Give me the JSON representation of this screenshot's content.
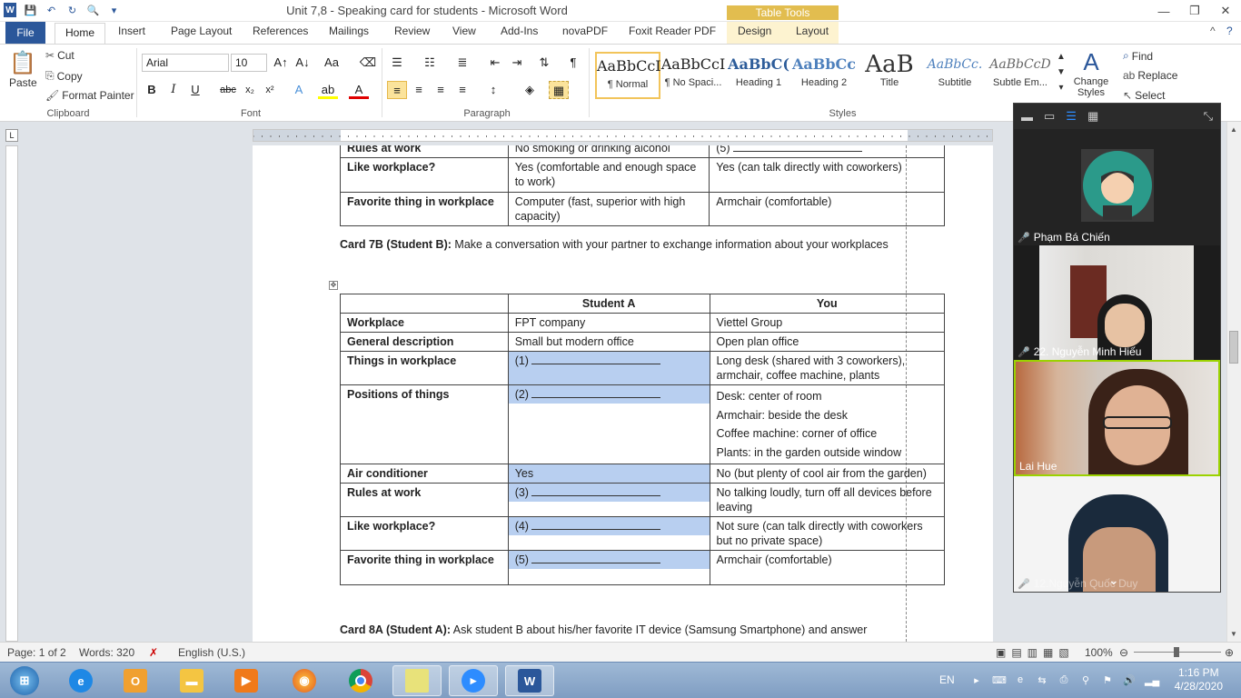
{
  "window": {
    "title": "Unit 7,8 - Speaking card for students - Microsoft Word",
    "context_tab_group": "Table Tools",
    "controls": [
      "—",
      "❐",
      "✕"
    ]
  },
  "tabs": {
    "file": "File",
    "items": [
      "Home",
      "Insert",
      "Page Layout",
      "References",
      "Mailings",
      "Review",
      "View",
      "Add-Ins",
      "novaPDF",
      "Foxit Reader PDF",
      "Design",
      "Layout"
    ]
  },
  "ribbon": {
    "clipboard": {
      "paste": "Paste",
      "cut": "Cut",
      "copy": "Copy",
      "format_painter": "Format Painter",
      "label": "Clipboard"
    },
    "font": {
      "name": "Arial",
      "size": "10",
      "label": "Font"
    },
    "paragraph": {
      "label": "Paragraph"
    },
    "styles": {
      "items": [
        {
          "preview": "AaBbCcI",
          "name": "¶ Normal"
        },
        {
          "preview": "AaBbCcI",
          "name": "¶ No Spaci..."
        },
        {
          "preview": "AaBbC(",
          "name": "Heading 1"
        },
        {
          "preview": "AaBbCc",
          "name": "Heading 2"
        },
        {
          "preview": "AaB",
          "name": "Title"
        },
        {
          "preview": "AaBbCc.",
          "name": "Subtitle"
        },
        {
          "preview": "AaBbCcD",
          "name": "Subtle Em..."
        }
      ],
      "change_styles": "Change Styles",
      "label": "Styles"
    },
    "editing": {
      "find": "Find",
      "replace": "Replace",
      "select": "Select"
    }
  },
  "document": {
    "top_table_rows": [
      {
        "label": "Rules at work",
        "a": "No smoking or drinking alcohol",
        "b": "(5)"
      },
      {
        "label": "Like workplace?",
        "a": "Yes (comfortable and enough space to work)",
        "b": "Yes (can talk directly with coworkers)"
      },
      {
        "label": "Favorite thing in workplace",
        "a": "Computer (fast, superior with high capacity)",
        "b": "Armchair (comfortable)"
      }
    ],
    "card7b": {
      "bold": "Card 7B (Student B):",
      "text": "Make a conversation with your partner to exchange information about your workplaces"
    },
    "table": {
      "headers": [
        "",
        "Student A",
        "You"
      ],
      "rows": [
        {
          "label": "Workplace",
          "a": "FPT company",
          "b": "Viettel Group"
        },
        {
          "label": "General description",
          "a": "Small but modern office",
          "b": "Open plan office"
        },
        {
          "label": "Things in workplace",
          "a": "(1)",
          "b": "Long desk (shared with 3 coworkers), armchair, coffee machine, plants"
        },
        {
          "label": "Positions of things",
          "a": "(2)",
          "b1": "Desk: center of room",
          "b2": "Armchair: beside the desk",
          "b3": "Coffee machine: corner of office",
          "b4": "Plants: in the garden outside window"
        },
        {
          "label": "Air conditioner",
          "a": "Yes",
          "b": "No (but plenty of cool air from the garden)"
        },
        {
          "label": "Rules at work",
          "a": "(3)",
          "b": "No talking loudly, turn off all devices before leaving"
        },
        {
          "label": "Like workplace?",
          "a": "(4)",
          "b": "Not sure (can talk directly with coworkers but no private space)"
        },
        {
          "label": "Favorite thing in workplace",
          "a": "(5)",
          "b": "Armchair (comfortable)"
        }
      ]
    },
    "card8a": {
      "bold": "Card 8A (Student A):",
      "text": "Ask student B about his/her favorite IT device (Samsung Smartphone) and answer"
    }
  },
  "statusbar": {
    "page": "Page: 1 of 2",
    "words": "Words: 320",
    "language": "English (U.S.)",
    "zoom": "100%"
  },
  "zoom_panel": {
    "participants": [
      {
        "name": "Phạm Bá Chiến",
        "muted": true
      },
      {
        "name": "22. Nguyễn Minh Hiếu",
        "muted": true
      },
      {
        "name": "Lai Hue",
        "muted": false
      },
      {
        "name": "12.Nguyễn Quốc Duy",
        "muted": true
      }
    ]
  },
  "taskbar": {
    "lang": "EN",
    "time": "1:16 PM",
    "date": "4/28/2020"
  }
}
